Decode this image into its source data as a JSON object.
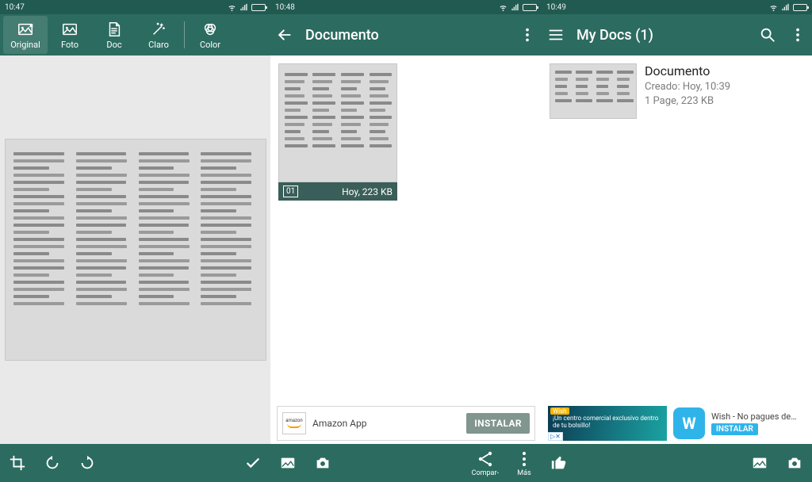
{
  "status": {
    "t1": "10:47",
    "t2": "10:48",
    "t3": "10:49"
  },
  "p1": {
    "tools": {
      "original": "Original",
      "foto": "Foto",
      "doc": "Doc",
      "claro": "Claro",
      "color": "Color"
    }
  },
  "p2": {
    "title": "Documento",
    "thumb": {
      "index": "01",
      "caption": "Hoy, 223 KB"
    },
    "bottom": {
      "compartir": "Compar-",
      "mas": "Más"
    },
    "ad": {
      "brand": "amazon",
      "title": "Amazon App",
      "cta": "INSTALAR"
    }
  },
  "p3": {
    "title": "My Docs (1)",
    "item": {
      "title": "Documento",
      "line1": "Creado: Hoy, 10:39",
      "line2": "1 Page, 223 KB"
    },
    "ad": {
      "tag": "Wish",
      "copy": "¡Un centro comercial exclusivo dentro de tu bolsillo!",
      "title": "Wish - No pagues de…",
      "cta": "INSTALAR",
      "adchoices": "▷✕"
    }
  }
}
